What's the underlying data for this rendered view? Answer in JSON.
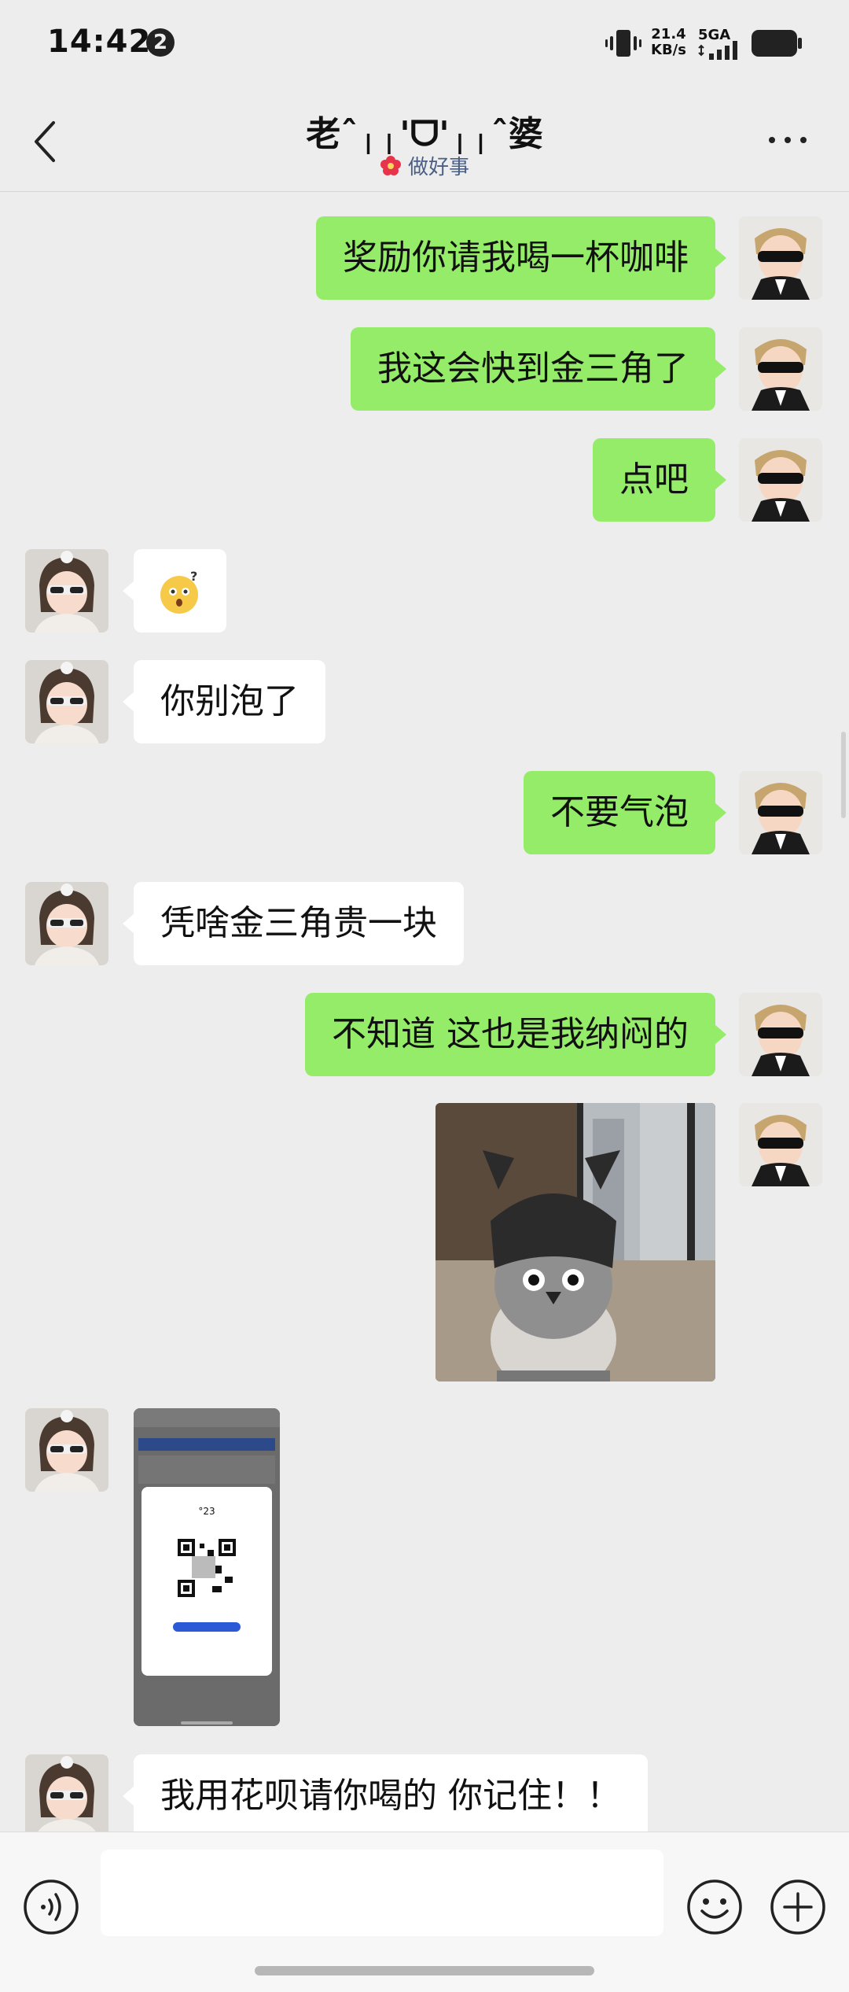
{
  "status_bar": {
    "time": "14:42",
    "notification_count": "2",
    "net_speed_value": "21.4",
    "net_speed_unit": "KB/s",
    "network_type": "5GA",
    "icons": [
      "vibrate-icon",
      "signal-icon",
      "battery-icon"
    ]
  },
  "header": {
    "title": "老ˆ╷╷'ᗜ'╷╷ˆ婆",
    "status_text": "做好事",
    "status_icon": "flower-icon",
    "back_icon": "chevron-left-icon",
    "more_icon": "more-dots-icon"
  },
  "messages": [
    {
      "from": "me",
      "type": "text",
      "text": "奖励你请我喝一杯咖啡"
    },
    {
      "from": "me",
      "type": "text",
      "text": "我这会快到金三角了"
    },
    {
      "from": "me",
      "type": "text",
      "text": "点吧"
    },
    {
      "from": "them",
      "type": "emoji",
      "icon": "confused-face-emoji"
    },
    {
      "from": "them",
      "type": "text",
      "text": "你别泡了"
    },
    {
      "from": "me",
      "type": "text",
      "text": "不要气泡"
    },
    {
      "from": "them",
      "type": "text",
      "text": "凭啥金三角贵一块"
    },
    {
      "from": "me",
      "type": "text",
      "text": "不知道 这也是我纳闷的"
    },
    {
      "from": "me",
      "type": "image",
      "icon": "penguin-photo"
    },
    {
      "from": "them",
      "type": "image",
      "icon": "order-screenshot",
      "caption": "°23"
    },
    {
      "from": "them",
      "type": "text",
      "text": "我用花呗请你喝的 你记住！！"
    }
  ],
  "input_bar": {
    "placeholder": "",
    "value": "",
    "voice_icon": "voice-icon",
    "emoji_icon": "emoji-icon",
    "plus_icon": "plus-icon"
  },
  "colors": {
    "background": "#ededed",
    "my_bubble": "#95ec69",
    "their_bubble": "#ffffff",
    "status_text": "#4a5f85"
  }
}
